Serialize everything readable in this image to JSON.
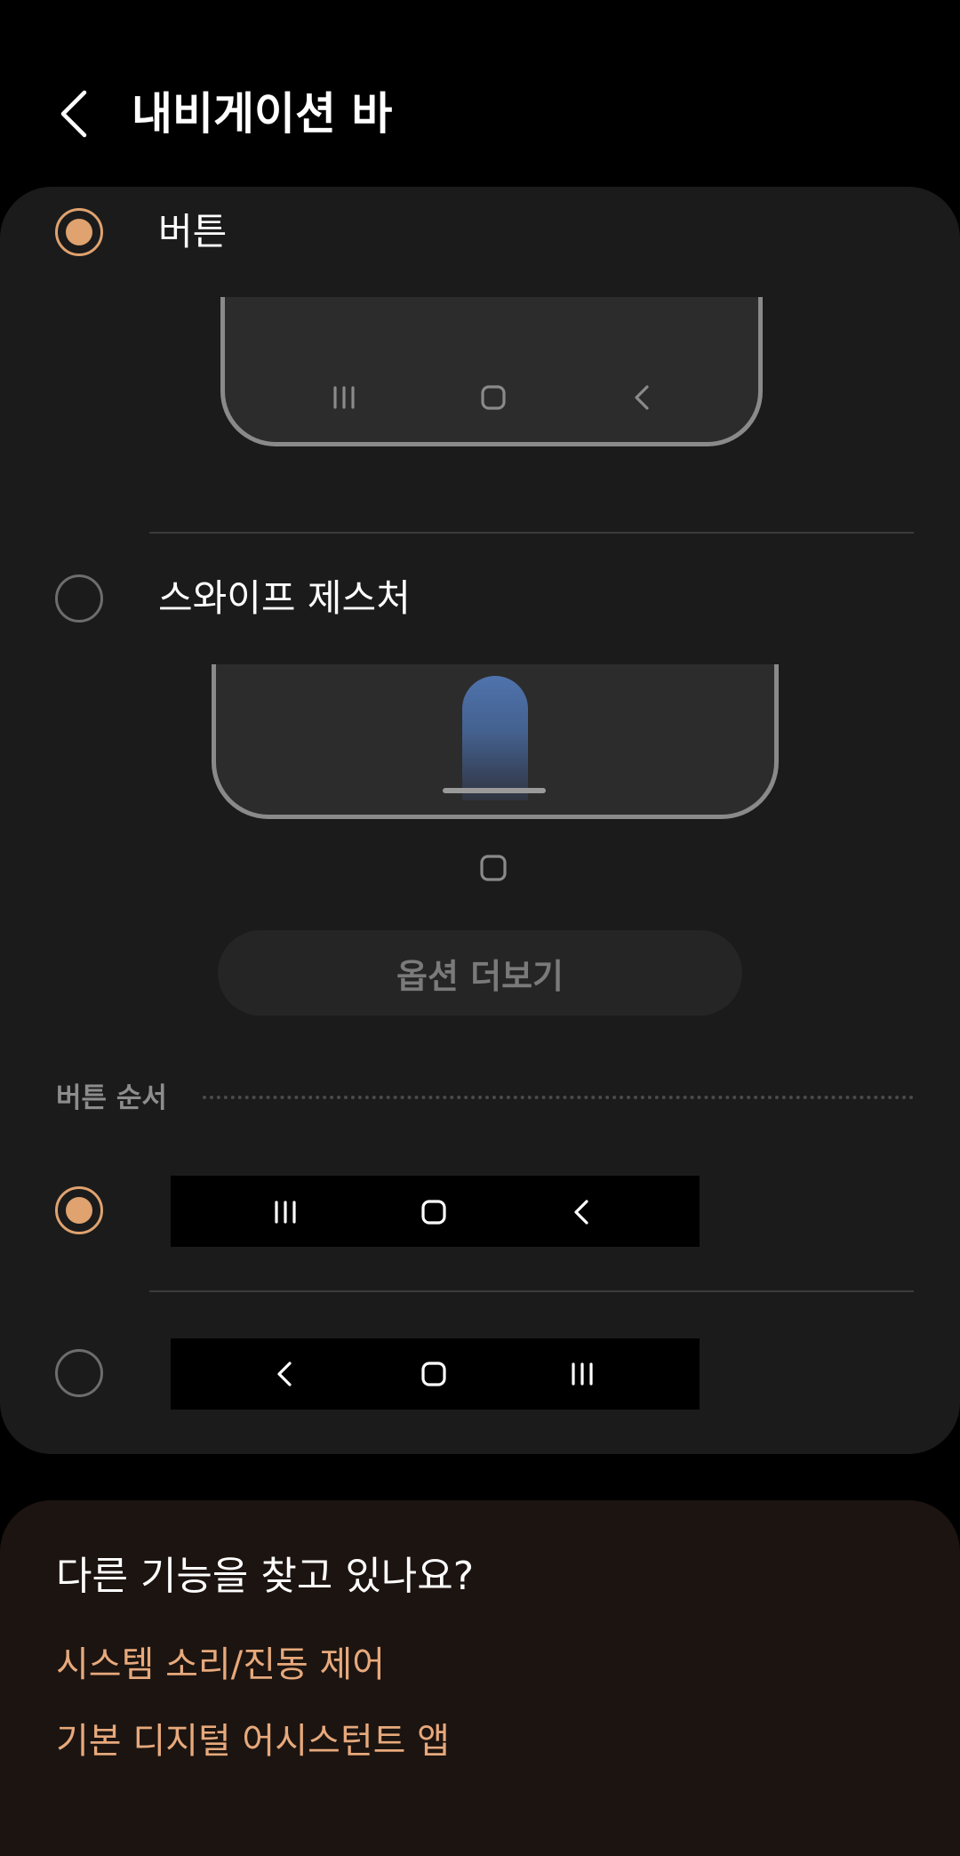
{
  "header": {
    "title": "내비게이션 바"
  },
  "nav_type": {
    "options": [
      {
        "label": "버튼",
        "selected": true
      },
      {
        "label": "스와이프 제스처",
        "selected": false
      }
    ],
    "more_options_label": "옵션 더보기"
  },
  "button_order": {
    "header": "버튼 순서",
    "options": [
      {
        "order": [
          "recents-icon",
          "home-icon",
          "back-icon"
        ],
        "selected": true
      },
      {
        "order": [
          "back-icon",
          "home-icon",
          "recents-icon"
        ],
        "selected": false
      }
    ]
  },
  "suggestions": {
    "title": "다른 기능을 찾고 있나요?",
    "links": [
      "시스템 소리/진동 제어",
      "기본 디지털 어시스턴트 앱"
    ]
  },
  "colors": {
    "accent": "#e0a26f",
    "link": "#e7a97c",
    "card": "#1b1b1b",
    "background": "#000000"
  }
}
